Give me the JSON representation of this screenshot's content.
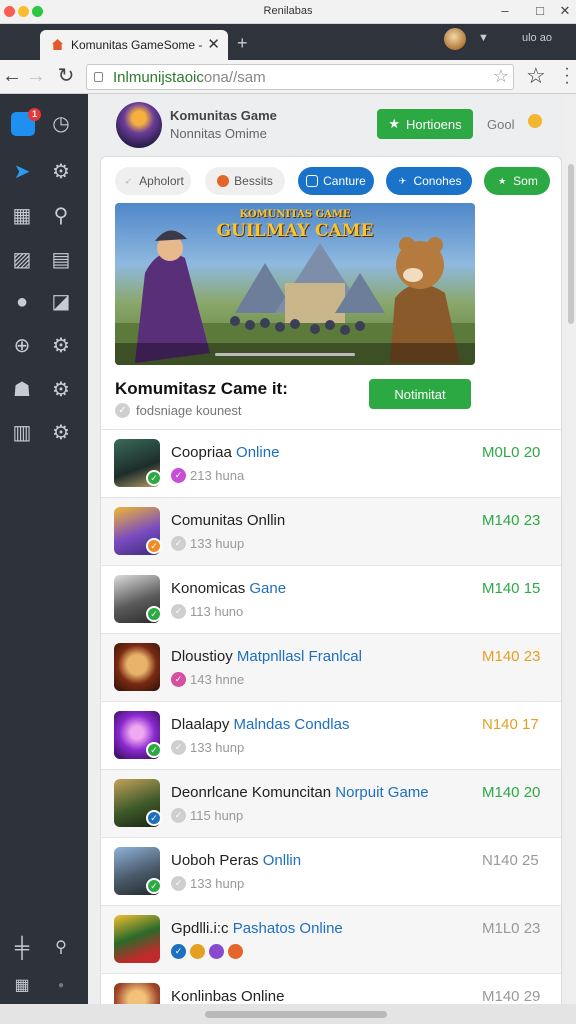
{
  "window": {
    "title": "Renilabas",
    "controls": [
      "–",
      "□",
      "✕"
    ]
  },
  "tab": {
    "title": "Komunitas GameSome -",
    "close": "✕",
    "new_tab": "+"
  },
  "profile": {
    "text": "ulo ao"
  },
  "address": {
    "host": "Inlmunijstaoic",
    "path": "ona//sam"
  },
  "sidebar": {
    "badge_count": "1",
    "icons": [
      "message-icon",
      "clock-icon",
      "send-icon",
      "gear-icon",
      "grid-icon",
      "search-icon",
      "image-icon",
      "clipboard-icon",
      "chat-icon",
      "edit-icon",
      "globe-icon",
      "gear-icon",
      "person-icon",
      "gear-icon",
      "book-icon",
      "gear-icon",
      "plus-icon",
      "search-icon",
      "apps-icon",
      "dot-icon"
    ]
  },
  "header": {
    "name": "Komunitas Game",
    "subtitle": "Nonnitas Omime",
    "button_label": "Hortioens",
    "goal_label": "Gool"
  },
  "filters": [
    {
      "label": "Apholort",
      "style": "gray",
      "icon": "rocket-icon"
    },
    {
      "label": "Bessits",
      "style": "gray",
      "icon": "orange-dot-icon"
    },
    {
      "label": "Canture",
      "style": "blue",
      "icon": "square-icon"
    },
    {
      "label": "Conohes",
      "style": "blue",
      "icon": "bird-icon"
    },
    {
      "label": "Som",
      "style": "green",
      "icon": "star-icon"
    }
  ],
  "banner": {
    "line1": "KOMUNITAS GAME",
    "line2": "GUILMAY CAME"
  },
  "game": {
    "title": "Komumitasz Came it:",
    "subtitle": "fodsniage kounest",
    "notify_label": "Notimitat"
  },
  "items": [
    {
      "title": "Coopriaa ",
      "title_hl": "Online",
      "meta": "213 huna",
      "meta_dot": "#c64fd6",
      "badge": "#2da944",
      "price": "M0L0 20",
      "price_color": "#2da944",
      "thumb": "linear-gradient(160deg,#3a6a5a,#1d2d2a 60%,#b9a06a)"
    },
    {
      "title": "Comunitas Onllin",
      "title_hl": "",
      "meta": "133 huup",
      "meta_dot": "#cfcfcf",
      "badge": "#f08a24",
      "price": "M140 23",
      "price_color": "#2da944",
      "thumb": "linear-gradient(160deg,#f1b734,#7a4cc0 55%,#3d2a7a)"
    },
    {
      "title": "Konomicas ",
      "title_hl": "Gane",
      "meta": "113 huno",
      "meta_dot": "#cfcfcf",
      "badge": "#2da944",
      "price": "M140 15",
      "price_color": "#2da944",
      "thumb": "linear-gradient(160deg,#dcdcdc,#5a5a5a 55%,#2a2a2a)"
    },
    {
      "title": "Dloustioy ",
      "title_hl": "Matpnllasl Franlcal",
      "meta": "143 hnne",
      "meta_dot": "#d64fa0",
      "badge": "",
      "price": "M140 23",
      "price_color": "#e5a022",
      "thumb": "radial-gradient(circle at 50% 45%,#e8b26a 0 28%,#7a2a12 55%,#2a1208)"
    },
    {
      "title": "Dlaalapy ",
      "title_hl": "Malndas Condlas",
      "meta": "133 hunp",
      "meta_dot": "#cfcfcf",
      "badge": "#2da944",
      "price": "N140 17",
      "price_color": "#e5a022",
      "thumb": "radial-gradient(circle at 50% 45%,#f0a9f0 0 18%,#8a2ad0 50%,#2a0a4a)"
    },
    {
      "title": "Deonrlcane Komuncitan ",
      "title_hl": "Norpuit Game",
      "meta": "115 hunp",
      "meta_dot": "#cfcfcf",
      "badge": "#1d6fc0",
      "price": "M140 20",
      "price_color": "#2da944",
      "thumb": "linear-gradient(160deg,#c2a25a,#3f5a2a 55%,#1a2412)"
    },
    {
      "title": "Uoboh Peras ",
      "title_hl": "Onllin",
      "meta": "133 hunp",
      "meta_dot": "#cfcfcf",
      "badge": "#2da944",
      "price": "N140 25",
      "price_color": "#999999",
      "thumb": "linear-gradient(160deg,#8fb3d9,#4a5a6a 55%,#22282e)"
    },
    {
      "title": "Gpdlli.i:c ",
      "title_hl": "Pashatos Online",
      "meta": "",
      "meta_dot": "#1d6fc0",
      "badge": "",
      "price": "M1L0 23",
      "price_color": "#999999",
      "thumb": "linear-gradient(160deg,#f2c030,#2a6a2a 45%,#c02a2a 80%)"
    },
    {
      "title": "Konlinbas Online",
      "title_hl": "",
      "meta": "",
      "meta_dot": "",
      "badge": "",
      "price": "M140 29",
      "price_color": "#999999",
      "thumb": "radial-gradient(circle at 50% 35%,#f3c27a 0 22%,#a0482a 55%,#4a1a0a)"
    }
  ]
}
